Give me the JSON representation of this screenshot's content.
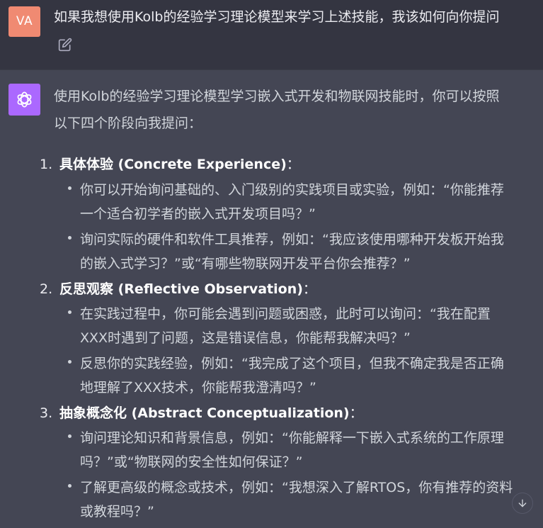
{
  "user": {
    "avatar_initials": "VA",
    "message": "如果我想使用Kolb的经验学习理论模型来学习上述技能，我该如何向你提问"
  },
  "assistant": {
    "intro_line1": "使用Kolb的经验学习理论模型学习嵌入式开发和物联网技能时，你可以按照",
    "intro_line2": "以下四个阶段向我提问：",
    "items": [
      {
        "number": "1.",
        "title_bold": "具体体验 (Concrete Experience)",
        "title_suffix": "：",
        "bullets": [
          [
            "你可以开始询问基础的、入门级别的实践项目或实验，例如：“你能推荐",
            "一个适合初学者的嵌入式开发项目吗？”"
          ],
          [
            "询问实际的硬件和软件工具推荐，例如：“我应该使用哪种开发板开始我",
            "的嵌入式学习？”或“有哪些物联网开发平台你会推荐？”"
          ]
        ]
      },
      {
        "number": "2.",
        "title_bold": "反思观察 (Reflective Observation)",
        "title_suffix": "：",
        "bullets": [
          [
            "在实践过程中，你可能会遇到问题或困惑，此时可以询问：“我在配置",
            "XXX时遇到了问题，这是错误信息，你能帮我解决吗？”"
          ],
          [
            "反思你的实践经验，例如：“我完成了这个项目，但我不确定我是否正确",
            "地理解了XXX技术，你能帮我澄清吗？”"
          ]
        ]
      },
      {
        "number": "3.",
        "title_bold": "抽象概念化 (Abstract Conceptualization)",
        "title_suffix": "：",
        "bullets": [
          [
            "询问理论知识和背景信息，例如：“你能解释一下嵌入式系统的工作原理",
            "吗？”或“物联网的安全性如何保证？”"
          ],
          [
            "了解更高级的概念或技术，例如：“我想深入了解RTOS，你有推荐的资料",
            "或教程吗？”"
          ]
        ]
      }
    ]
  },
  "colors": {
    "user_bg": "#343541",
    "assistant_bg": "#444654",
    "user_avatar": "#f08a72",
    "ai_avatar": "#ab68ff"
  },
  "icons": {
    "edit": "edit-pencil-icon",
    "ai": "openai-logo-icon",
    "scroll": "arrow-down-icon"
  }
}
